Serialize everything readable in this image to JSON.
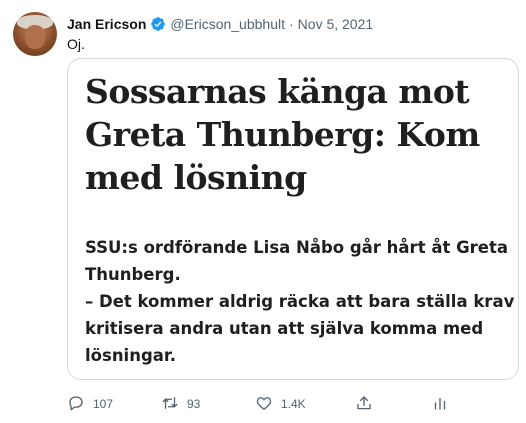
{
  "author": {
    "name": "Jan Ericson",
    "handle": "@Ericson_ubbhult",
    "separator": "·",
    "date": "Nov 5, 2021"
  },
  "tweet": {
    "text": "Oj."
  },
  "media": {
    "headline_lines": [
      "Sossarnas känga mot",
      "Greta Thunberg: Kom",
      "med lösning"
    ],
    "lead_lines": [
      "SSU:s ordförande Lisa Nåbo går hårt åt Greta",
      "Thunberg.",
      "– Det kommer aldrig räcka att bara ställa krav och",
      "kritisera andra utan att själva komma med",
      "lösningar."
    ]
  },
  "actions": {
    "reply_count": "107",
    "retweet_count": "93",
    "like_count": "1.4K"
  },
  "colors": {
    "verified": "#1d9bf0",
    "secondary_text": "#536471",
    "border": "#cfd9de"
  },
  "icons": [
    "verified-badge-icon",
    "reply-icon",
    "retweet-icon",
    "like-icon",
    "share-icon",
    "analytics-icon"
  ]
}
